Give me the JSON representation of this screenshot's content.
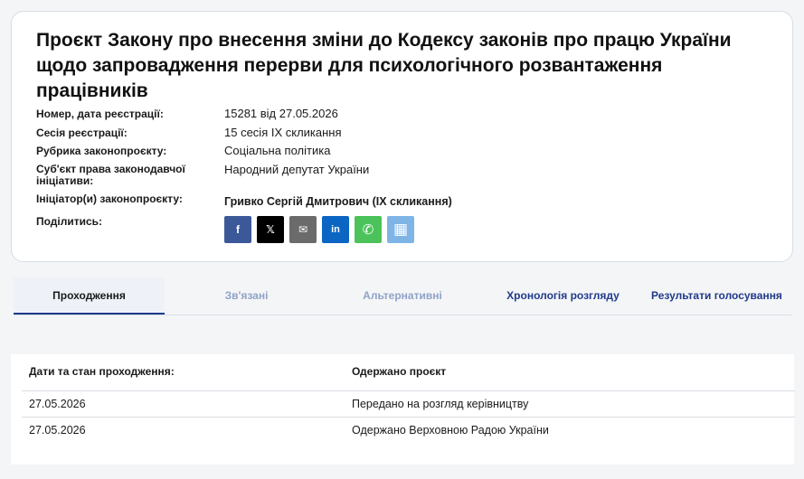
{
  "bill": {
    "title": "Проєкт Закону про внесення зміни до Кодексу законів про працю України щодо запровадження перерви для психологічного розвантаження працівників",
    "meta": [
      {
        "label": "Номер, дата реєстрації:",
        "value": "15281 від 27.05.2026"
      },
      {
        "label": "Сесія реєстрації:",
        "value": "15 сесія IX скликання"
      },
      {
        "label": "Рубрика законопроєкту:",
        "value": "Соціальна політика"
      },
      {
        "label": "Суб'єкт права законодавчої ініціативи:",
        "value": "Народний депутат України"
      },
      {
        "label": "Ініціатор(и) законопроєкту:",
        "value": "Гривко Сергій Дмитрович (IX скликання)"
      },
      {
        "label": "Поділитись:",
        "value": ""
      }
    ],
    "share": [
      {
        "name": "facebook",
        "glyph": "f",
        "color": "#3b5998"
      },
      {
        "name": "x",
        "glyph": "𝕏",
        "color": "#000000"
      },
      {
        "name": "email",
        "glyph": "✉",
        "color": "#6b6b6b"
      },
      {
        "name": "linkedin",
        "glyph": "in",
        "color": "#0a66c2"
      },
      {
        "name": "whatsapp",
        "glyph": "✆",
        "color": "#4cc35a"
      },
      {
        "name": "qr-code",
        "glyph": "▦",
        "color": "#7fb5e6"
      }
    ]
  },
  "tabs": [
    "Проходження",
    "Зв'язані",
    "Альтернативні",
    "Хронологія розгляду",
    "Результати голосування"
  ],
  "passage": {
    "headers": [
      "Дати та стан проходження:",
      "Одержано проєкт"
    ],
    "rows": [
      {
        "date": "27.05.2026",
        "status": "Передано на розгляд керівництву"
      },
      {
        "date": "27.05.2026",
        "status": "Одержано Верховною Радою України"
      }
    ]
  }
}
